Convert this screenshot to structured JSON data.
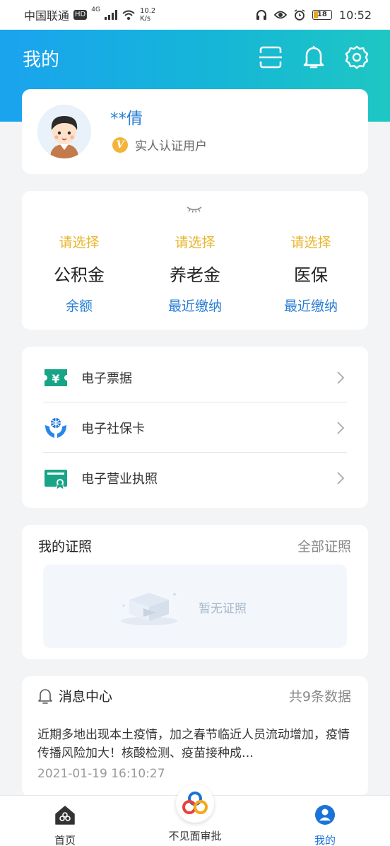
{
  "status_bar": {
    "carrier": "中国联通",
    "hd": "HD",
    "network": "4G",
    "speed_value": "10.2",
    "speed_unit": "K/s",
    "battery": "18",
    "time": "10:52"
  },
  "header": {
    "title": "我的",
    "icons": [
      "scan-icon",
      "bell-icon",
      "gear-icon"
    ],
    "gradient_start": "#1aa3ef",
    "gradient_end": "#1ec7c3"
  },
  "profile": {
    "name": "**倩",
    "verify_badge": "V",
    "verify_text": "实人认证用户"
  },
  "funds": {
    "items": [
      {
        "select": "请选择",
        "name": "公积金",
        "sub": "余额"
      },
      {
        "select": "请选择",
        "name": "养老金",
        "sub": "最近缴纳"
      },
      {
        "select": "请选择",
        "name": "医保",
        "sub": "最近缴纳"
      }
    ]
  },
  "services": {
    "items": [
      {
        "label": "电子票据",
        "icon": "receipt-icon"
      },
      {
        "label": "电子社保卡",
        "icon": "social-security-icon"
      },
      {
        "label": "电子营业执照",
        "icon": "license-icon"
      }
    ]
  },
  "certificates": {
    "title": "我的证照",
    "all_link": "全部证照",
    "empty_text": "暂无证照"
  },
  "messages": {
    "title": "消息中心",
    "count": "共9条数据",
    "body": "近期多地出现本土疫情，加之春节临近人员流动增加，疫情传播风险加大！核酸检测、疫苗接种成…",
    "time": "2021-01-19 16:10:27"
  },
  "bottom_nav": {
    "home": "首页",
    "center": "不见面审批",
    "mine": "我的"
  },
  "colors": {
    "accent_blue": "#2a7fd6",
    "select_yellow": "#e7b42a",
    "nav_active": "#1a73d9"
  }
}
